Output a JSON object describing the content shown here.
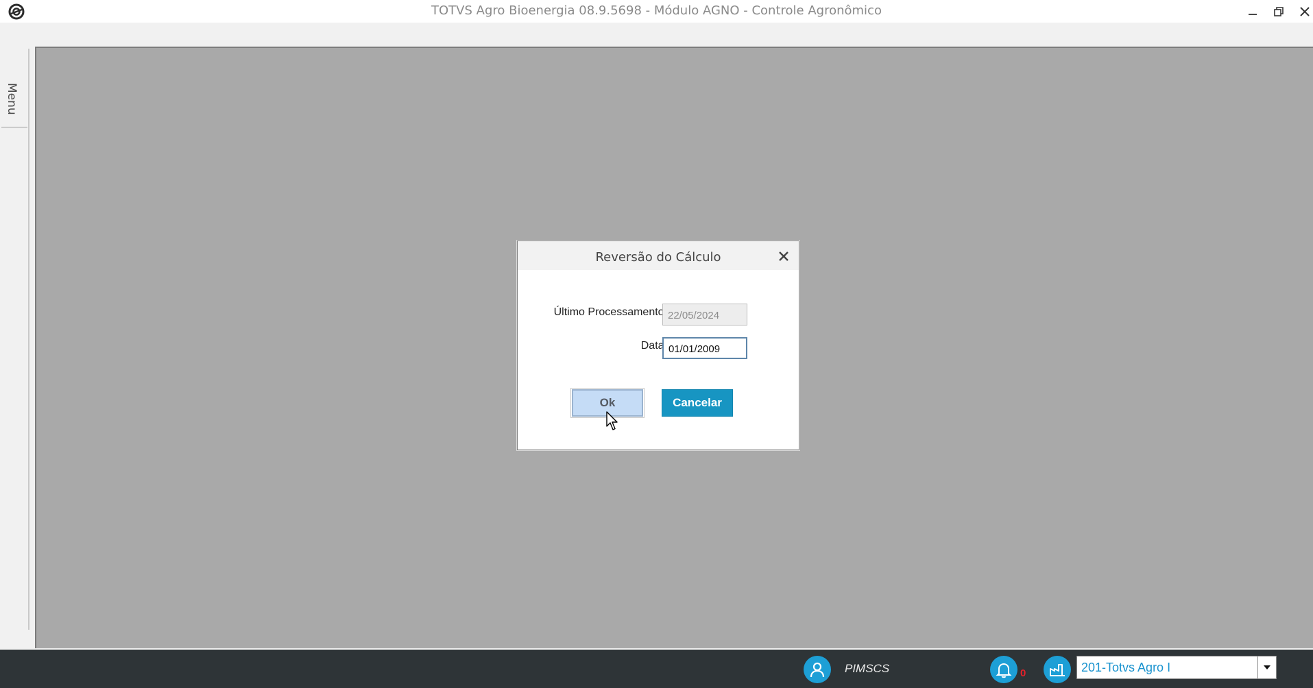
{
  "window": {
    "title": "TOTVS Agro Bioenergia 08.9.5698 - Módulo AGNO - Controle Agronômico"
  },
  "sidebar": {
    "menu_label": "Menu"
  },
  "dialog": {
    "title": "Reversão do Cálculo",
    "fields": {
      "ultimo_label": "Último Processamento:",
      "ultimo_value": "22/05/2024",
      "data_label": "Data:",
      "data_value": "01/01/2009"
    },
    "buttons": {
      "ok": "Ok",
      "cancel": "Cancelar"
    }
  },
  "statusbar": {
    "username": "PIMSCS",
    "notifications_count": "0",
    "company": "201-Totvs Agro I"
  },
  "colors": {
    "accent": "#1d9fd6",
    "cancel_button": "#1795c2",
    "ok_button": "#c5dcf6",
    "workspace": "#a9a9a9",
    "statusbar": "#2e3437",
    "notification_count": "#e8202a"
  },
  "icons": {
    "app": "totvs-logo-icon",
    "minimize": "minimize-icon",
    "restore": "restore-icon",
    "close": "close-icon",
    "dialog_close": "close-icon",
    "user": "user-icon",
    "notifications": "bell-icon",
    "company": "factory-icon",
    "dropdown": "chevron-down-icon"
  }
}
